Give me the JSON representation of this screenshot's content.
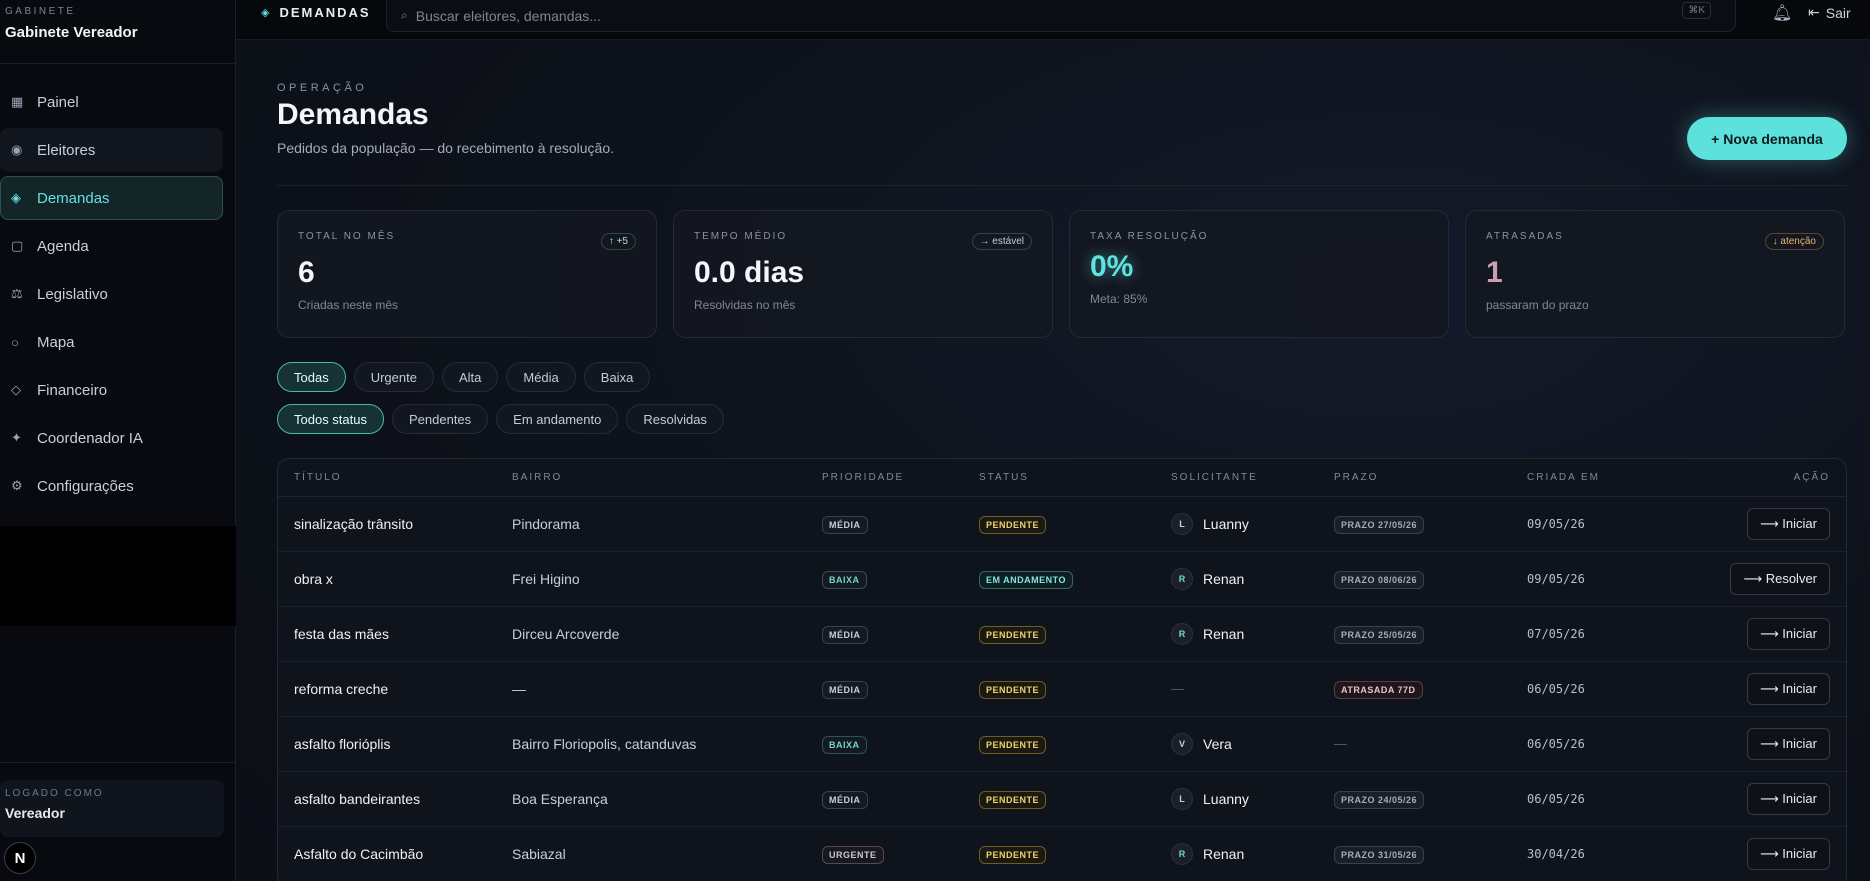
{
  "brand": {
    "eyebrow": "GABINETE",
    "name": "Gabinete Vereador"
  },
  "nav": [
    {
      "icon": "grid-icon",
      "glyph": "▦",
      "label": "Painel"
    },
    {
      "icon": "users-icon",
      "glyph": "◉",
      "label": "Eleitores"
    },
    {
      "icon": "diamond-icon",
      "glyph": "◈",
      "label": "Demandas",
      "active": true
    },
    {
      "icon": "calendar-icon",
      "glyph": "▢",
      "label": "Agenda"
    },
    {
      "icon": "scales-icon",
      "glyph": "⚖",
      "label": "Legislativo"
    },
    {
      "icon": "globe-icon",
      "glyph": "○",
      "label": "Mapa"
    },
    {
      "icon": "finance-icon",
      "glyph": "◇",
      "label": "Financeiro"
    },
    {
      "icon": "sparkle-icon",
      "glyph": "✦",
      "label": "Coordenador IA"
    },
    {
      "icon": "gear-icon",
      "glyph": "⚙",
      "label": "Configurações"
    }
  ],
  "user": {
    "eyebrow": "LOGADO COMO",
    "name": "Vereador",
    "badge": "N"
  },
  "topbar": {
    "crumb": "DEMANDAS",
    "search_placeholder": "Buscar eleitores, demandas...",
    "shortcut": "⌘K",
    "logout": "Sair"
  },
  "header": {
    "eyebrow": "OPERAÇÃO",
    "title": "Demandas",
    "subtitle": "Pedidos da população — do recebimento à resolução.",
    "new_button": "+ Nova demanda"
  },
  "stats": [
    {
      "label": "TOTAL NO MÊS",
      "value": "6",
      "foot": "Criadas neste mês",
      "chip": "↑ +5",
      "chip_tone": "green",
      "value_tone": ""
    },
    {
      "label": "TEMPO MÉDIO",
      "value": "0.0 dias",
      "foot": "Resolvidas no mês",
      "chip": "→ estável",
      "chip_tone": "",
      "value_tone": ""
    },
    {
      "label": "TAXA RESOLUÇÃO",
      "value": "0%",
      "foot": "Meta: 85%",
      "chip": "",
      "chip_tone": "",
      "value_tone": "cyan"
    },
    {
      "label": "ATRASADAS",
      "value": "1",
      "foot": "passaram do prazo",
      "chip": "↓ atenção",
      "chip_tone": "amber",
      "value_tone": "rose"
    }
  ],
  "priority_filters": [
    {
      "label": "Todas",
      "active": true
    },
    {
      "label": "Urgente"
    },
    {
      "label": "Alta"
    },
    {
      "label": "Média"
    },
    {
      "label": "Baixa"
    }
  ],
  "status_filters": [
    {
      "label": "Todos status",
      "active": true
    },
    {
      "label": "Pendentes"
    },
    {
      "label": "Em andamento"
    },
    {
      "label": "Resolvidas"
    }
  ],
  "table": {
    "columns": [
      "TÍTULO",
      "BAIRRO",
      "PRIORIDADE",
      "STATUS",
      "SOLICITANTE",
      "PRAZO",
      "CRIADA EM",
      "AÇÃO"
    ],
    "rows": [
      {
        "titulo": "sinalização trânsito",
        "bairro": "Pindorama",
        "prioridade": "MÉDIA",
        "p_tone": "media",
        "status": "PENDENTE",
        "s_tone": "pendente",
        "avatar": "L",
        "solicitante": "Luanny",
        "prazo": "PRAZO 27/05/26",
        "prazo_tone": "prazo",
        "criada": "09/05/26",
        "acao": "⟶ Iniciar"
      },
      {
        "titulo": "obra x",
        "bairro": "Frei Higino",
        "prioridade": "BAIXA",
        "p_tone": "baixa",
        "status": "EM ANDAMENTO",
        "s_tone": "andamento",
        "avatar": "R",
        "solicitante": "Renan",
        "prazo": "PRAZO 08/06/26",
        "prazo_tone": "prazo",
        "criada": "09/05/26",
        "acao": "⟶ Resolver"
      },
      {
        "titulo": "festa das mães",
        "bairro": "Dirceu Arcoverde",
        "prioridade": "MÉDIA",
        "p_tone": "media",
        "status": "PENDENTE",
        "s_tone": "pendente",
        "avatar": "R",
        "solicitante": "Renan",
        "prazo": "PRAZO 25/05/26",
        "prazo_tone": "prazo",
        "criada": "07/05/26",
        "acao": "⟶ Iniciar"
      },
      {
        "titulo": "reforma creche",
        "bairro": "—",
        "prioridade": "MÉDIA",
        "p_tone": "media",
        "status": "PENDENTE",
        "s_tone": "pendente",
        "avatar": "",
        "solicitante": "—",
        "prazo": "ATRASADA 77D",
        "prazo_tone": "atrasada",
        "criada": "06/05/26",
        "acao": "⟶ Iniciar"
      },
      {
        "titulo": "asfalto florióplis",
        "bairro": "Bairro Floriopolis, catanduvas",
        "prioridade": "BAIXA",
        "p_tone": "baixa",
        "status": "PENDENTE",
        "s_tone": "pendente",
        "avatar": "V",
        "solicitante": "Vera",
        "prazo": "—",
        "prazo_tone": "none",
        "criada": "06/05/26",
        "acao": "⟶ Iniciar"
      },
      {
        "titulo": "asfalto bandeirantes",
        "bairro": "Boa Esperança",
        "prioridade": "MÉDIA",
        "p_tone": "media",
        "status": "PENDENTE",
        "s_tone": "pendente",
        "avatar": "L",
        "solicitante": "Luanny",
        "prazo": "PRAZO 24/05/26",
        "prazo_tone": "prazo",
        "criada": "06/05/26",
        "acao": "⟶ Iniciar"
      },
      {
        "titulo": "Asfalto do Cacimbão",
        "bairro": "Sabiazal",
        "prioridade": "URGENTE",
        "p_tone": "urgente",
        "status": "PENDENTE",
        "s_tone": "pendente",
        "avatar": "R",
        "solicitante": "Renan",
        "prazo": "PRAZO 31/05/26",
        "prazo_tone": "prazo",
        "criada": "30/04/26",
        "acao": "⟶ Iniciar"
      }
    ]
  }
}
